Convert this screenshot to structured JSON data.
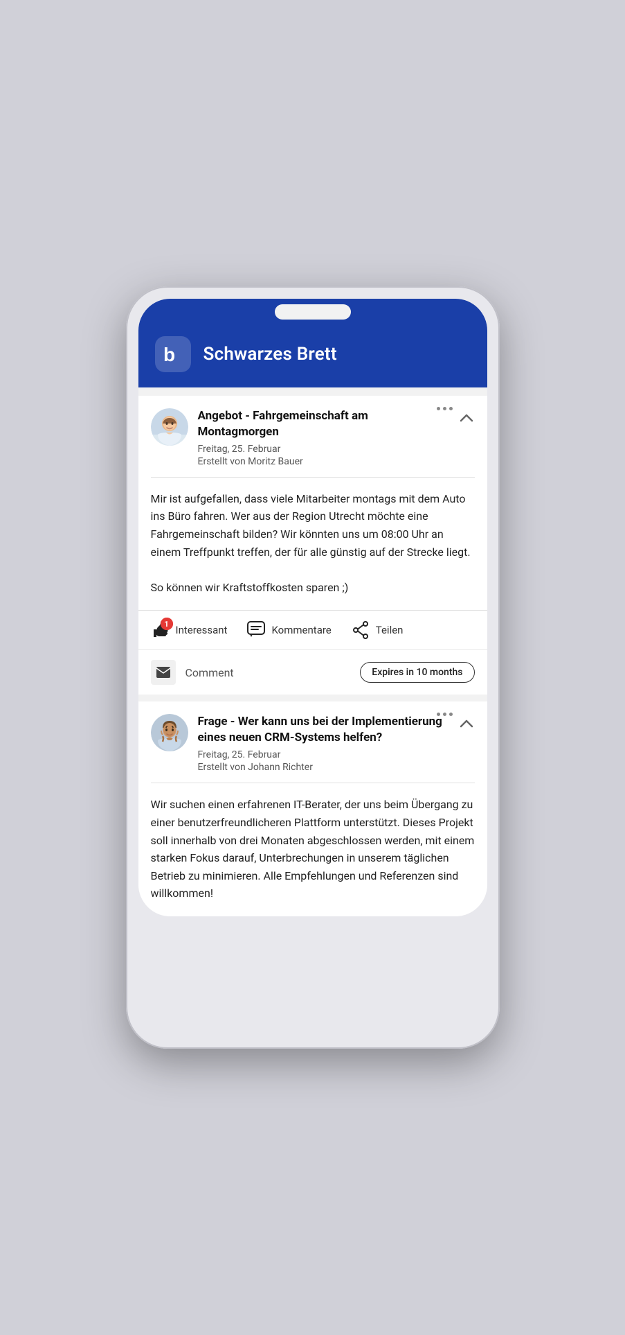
{
  "app": {
    "title": "Schwarzes Brett",
    "logo_letter": "b"
  },
  "posts": [
    {
      "id": "post-1",
      "tag": "Angebot",
      "title": "Angebot - Fahrgemeinschaft am Montagmorgen",
      "date": "Freitag, 25. Februar",
      "author_label": "Erstellt von Moritz Bauer",
      "body_paragraphs": [
        "Mir ist aufgefallen, dass viele Mitarbeiter montags mit dem Auto ins Büro fahren. Wer aus der Region Utrecht möchte eine Fahrgemeinschaft bilden? Wir könnten uns um 08:00 Uhr an einem Treffpunkt treffen, der für alle günstig auf der Strecke liegt.",
        "So können wir Kraftstoffkosten sparen ;)"
      ],
      "actions": {
        "interessant_label": "Interessant",
        "interessant_count": "1",
        "kommentare_label": "Kommentare",
        "teilen_label": "Teilen"
      },
      "footer": {
        "comment_label": "Comment",
        "expires_label": "Expires in 10 months"
      }
    },
    {
      "id": "post-2",
      "tag": "Frage",
      "title": "Frage - Wer kann uns bei der Implementierung eines neuen CRM-Systems helfen?",
      "date": "Freitag, 25. Februar",
      "author_label": "Erstellt von Johann Richter",
      "body_paragraphs": [
        "Wir suchen einen erfahrenen IT-Berater, der uns beim Übergang zu einer benutzerfreundlicheren Plattform unterstützt. Dieses Projekt soll innerhalb von drei Monaten abgeschlossen werden, mit einem starken Fokus darauf, Unterbrechungen in unserem täglichen Betrieb zu minimieren. Alle Empfehlungen und Referenzen sind willkommen!"
      ]
    }
  ]
}
